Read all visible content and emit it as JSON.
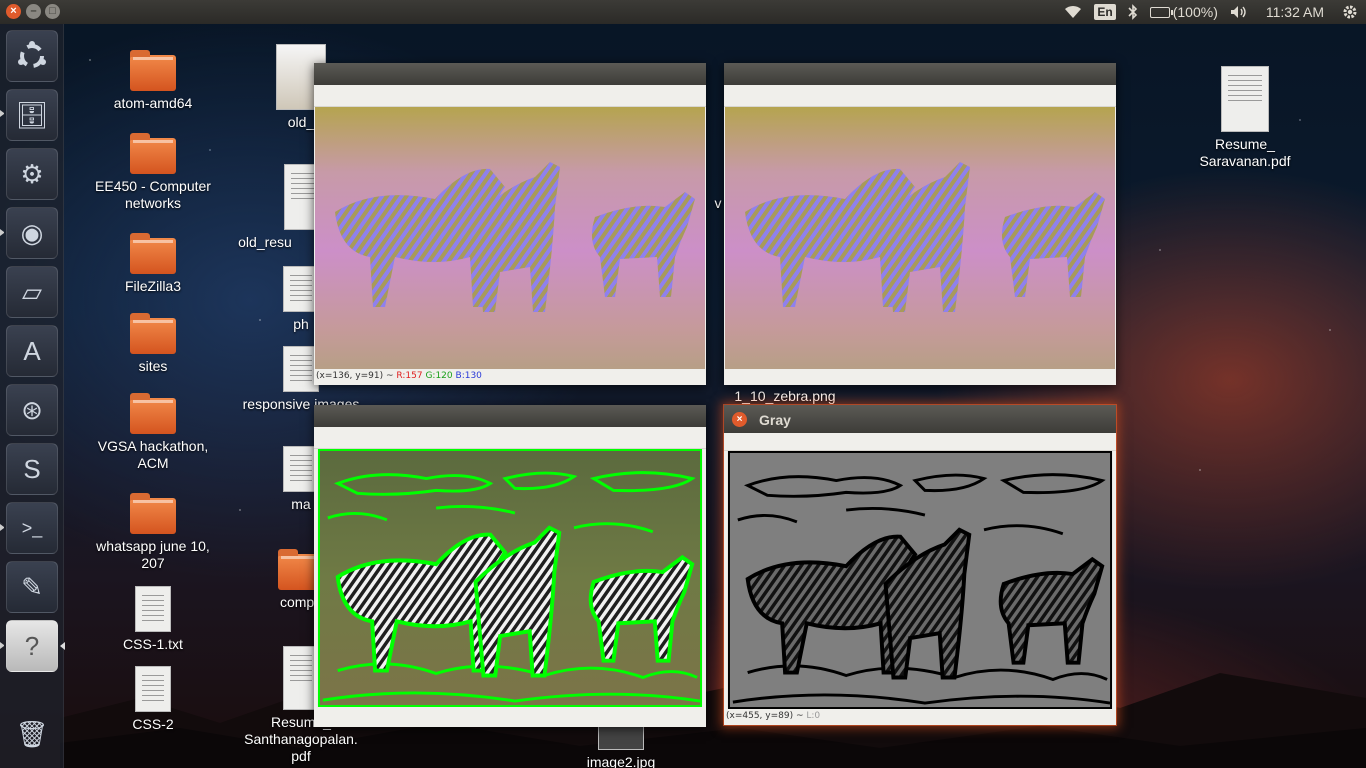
{
  "top_panel": {
    "language": "En",
    "battery": "(100%)",
    "clock": "11:32 AM"
  },
  "desktop_icons": [
    {
      "label": "atom-amd64",
      "kind": "folder"
    },
    {
      "label": "EE450 - Computer networks",
      "kind": "folder"
    },
    {
      "label": "FileZilla3",
      "kind": "folder"
    },
    {
      "label": "sites",
      "kind": "folder"
    },
    {
      "label": "VGSA hackathon, ACM",
      "kind": "folder"
    },
    {
      "label": "whatsapp june 10, 207",
      "kind": "folder"
    },
    {
      "label": "CSS-1.txt",
      "kind": "file"
    },
    {
      "label": "CSS-2",
      "kind": "file"
    },
    {
      "label": "old_",
      "kind": "image"
    },
    {
      "label": "old_resu",
      "kind": "file"
    },
    {
      "label": "ph",
      "kind": "file"
    },
    {
      "label": "responsive images",
      "kind": "file"
    },
    {
      "label": "ma",
      "kind": "file"
    },
    {
      "label": "compa",
      "kind": "folder"
    },
    {
      "label": "Resume_ Santhanagopalan. pdf",
      "kind": "file"
    },
    {
      "label": "image2.jpg",
      "kind": "image"
    },
    {
      "label": "1_10_zebra.png",
      "kind": "image"
    },
    {
      "label": "v",
      "kind": "image"
    },
    {
      "label": "Resume_ Saravanan.pdf",
      "kind": "file"
    }
  ],
  "windows": {
    "top_left": {
      "title": "",
      "status": {
        "coords": "(x=136, y=91) ~",
        "r": "R:157",
        "g": "G:120",
        "b": "B:130"
      }
    },
    "top_right": {
      "title": ""
    },
    "bottom_left": {
      "title": ""
    },
    "bottom_right": {
      "title": "Gray",
      "status": {
        "coords": "(x=455, y=89) ~",
        "l": "L:0"
      }
    }
  },
  "colors": {
    "accent": "#e05b2c",
    "contour": "#00ff00",
    "panel": "#3c3b37"
  }
}
